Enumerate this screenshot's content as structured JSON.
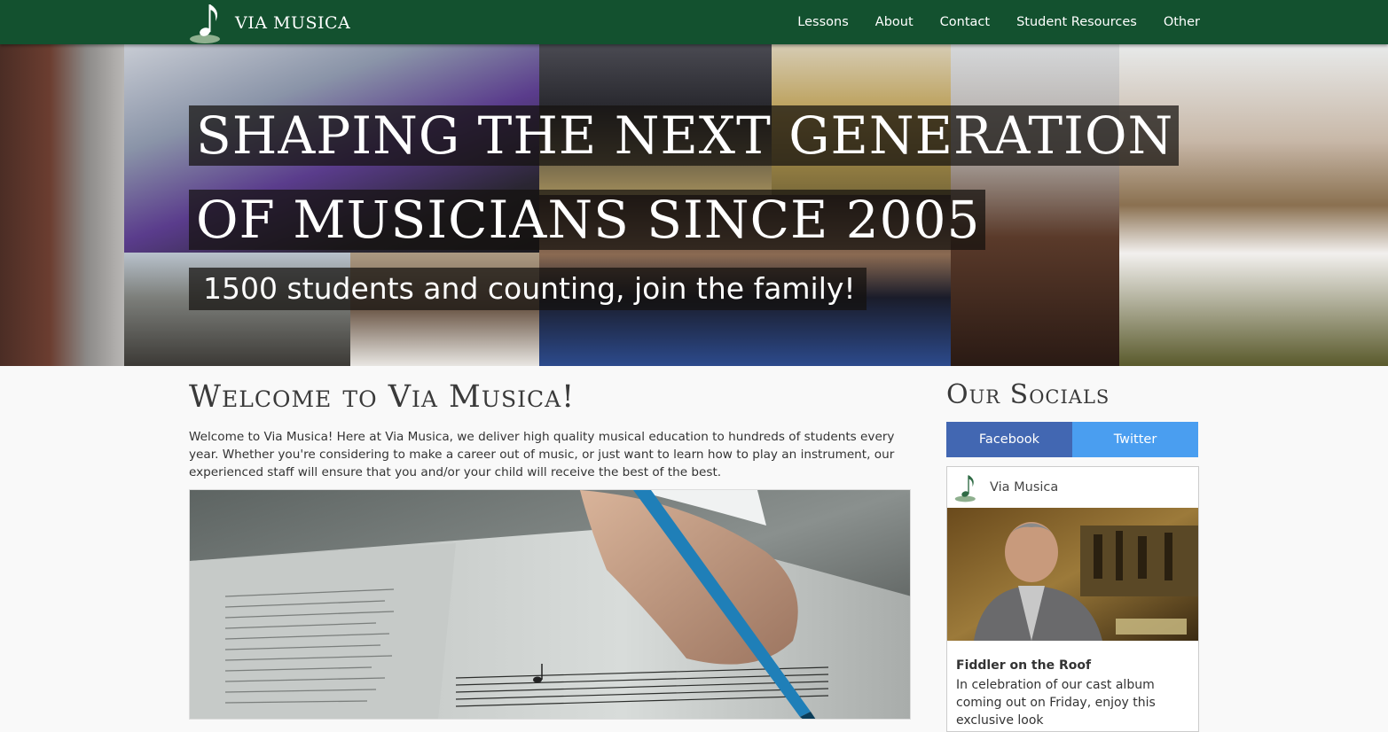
{
  "navbar": {
    "brand_name": "VIA MUSICA",
    "links": [
      "Lessons",
      "About",
      "Contact",
      "Student Resources",
      "Other"
    ]
  },
  "hero": {
    "headline_line1": "SHAPING THE NEXT GENERATION",
    "headline_line2": "OF MUSICIANS SINCE 2005",
    "subheadline": "1500 students and counting, join the family!"
  },
  "welcome": {
    "title": "Welcome to Via Musica!",
    "text": "Welcome to Via Musica! Here at Via Musica, we deliver high quality musical education to hundreds of students every year. Whether you're considering to make a career out of music, or just want to learn how to play an instrument, our experienced staff will ensure that you and/or your child will receive the best of the best."
  },
  "sidebar": {
    "title": "Our Socials",
    "tabs": {
      "facebook": "Facebook",
      "twitter": "Twitter"
    },
    "feed": {
      "page_name": "Via Musica",
      "post_title": "Fiddler on the Roof",
      "post_text": "In celebration of our cast album coming out on Friday, enjoy this exclusive look"
    }
  },
  "colors": {
    "navbar": "#13512f",
    "facebook": "#4267b2",
    "twitter": "#4a9ef0",
    "page_background": "#f9f9f9"
  },
  "icons": {
    "logo": "music-note-logo"
  }
}
